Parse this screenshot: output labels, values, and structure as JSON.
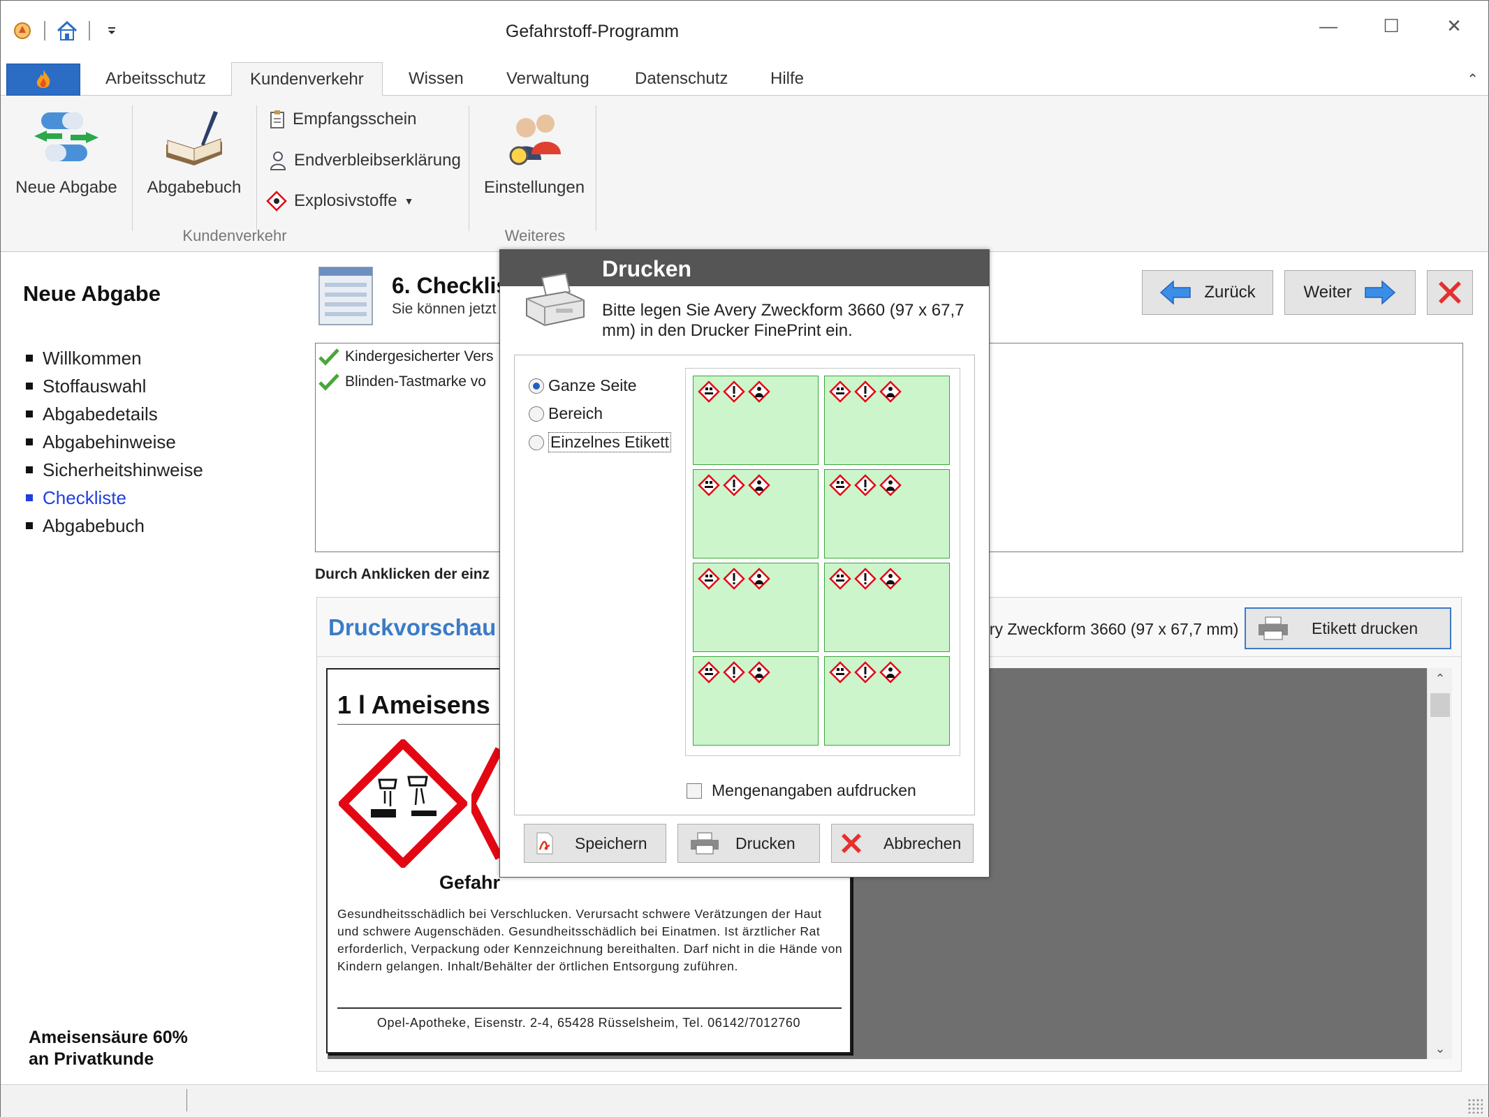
{
  "window": {
    "title": "Gefahrstoff-Programm",
    "controls": {
      "minimize": "—",
      "maximize": "☐",
      "close": "✕"
    }
  },
  "ribbon": {
    "tabs": [
      "Arbeitsschutz",
      "Kundenverkehr",
      "Wissen",
      "Verwaltung",
      "Datenschutz",
      "Hilfe"
    ],
    "active_tab": "Kundenverkehr",
    "buttons": {
      "neue_abgabe": "Neue Abgabe",
      "abgabebuch": "Abgabebuch",
      "empfangsschein": "Empfangsschein",
      "endverbleib": "Endverbleibserklärung",
      "explosivstoffe": "Explosivstoffe",
      "einstellungen": "Einstellungen"
    },
    "groups": {
      "kundenverkehr": "Kundenverkehr",
      "weiteres": "Weiteres"
    }
  },
  "sidebar": {
    "title": "Neue Abgabe",
    "items": [
      "Willkommen",
      "Stoffauswahl",
      "Abgabedetails",
      "Abgabehinweise",
      "Sicherheitshinweise",
      "Checkliste",
      "Abgabebuch"
    ],
    "active_index": 5,
    "footer_line1": "Ameisensäure 60%",
    "footer_line2": "an Privatkunde"
  },
  "main": {
    "step_title": "6. Checklis",
    "step_subtitle": "Sie können jetzt",
    "nav": {
      "back": "Zurück",
      "next": "Weiter"
    },
    "checklist": [
      "Kindergesicherter Vers",
      "Blinden-Tastmarke vo"
    ],
    "hint": "Durch Anklicken der einz",
    "preview": {
      "title": "Druckvorschau",
      "avery": "ery Zweckform 3660 (97 x 67,7 mm)",
      "print_button": "Etikett drucken"
    },
    "label": {
      "heading": "1 l Ameisens",
      "signal_word": "Gefahr",
      "hazard_text": "Gesundheitsschädlich bei Verschlucken. Verursacht schwere Verätzungen der Haut und schwere Augenschäden. Gesundheitsschädlich bei Einatmen. Ist ärztlicher Rat erforderlich, Verpackung oder Kennzeichnung bereithalten. Darf nicht in die Hände von Kindern gelangen. Inhalt/Behälter der örtlichen Entsorgung zuführen.",
      "pharmacy": "Opel-Apotheke, Eisenstr. 2-4, 65428 Rüsselsheim, Tel. 06142/7012760"
    }
  },
  "dialog": {
    "title": "Drucken",
    "message": "Bitte legen Sie Avery Zweckform 3660 (97 x 67,7 mm) in den Drucker FinePrint ein.",
    "options": [
      "Ganze Seite",
      "Bereich",
      "Einzelnes Etikett"
    ],
    "selected_option": "Ganze Seite",
    "label_count": 8,
    "checkbox": "Mengenangaben aufdrucken",
    "checkbox_checked": false,
    "buttons": {
      "save": "Speichern",
      "print": "Drucken",
      "cancel": "Abbrechen"
    }
  },
  "colors": {
    "accent_blue": "#3a7bc8",
    "active_nav": "#1f3fe0",
    "label_green": "#ccf5cc",
    "ghs_red": "#e30613",
    "dialog_header": "#555555"
  }
}
